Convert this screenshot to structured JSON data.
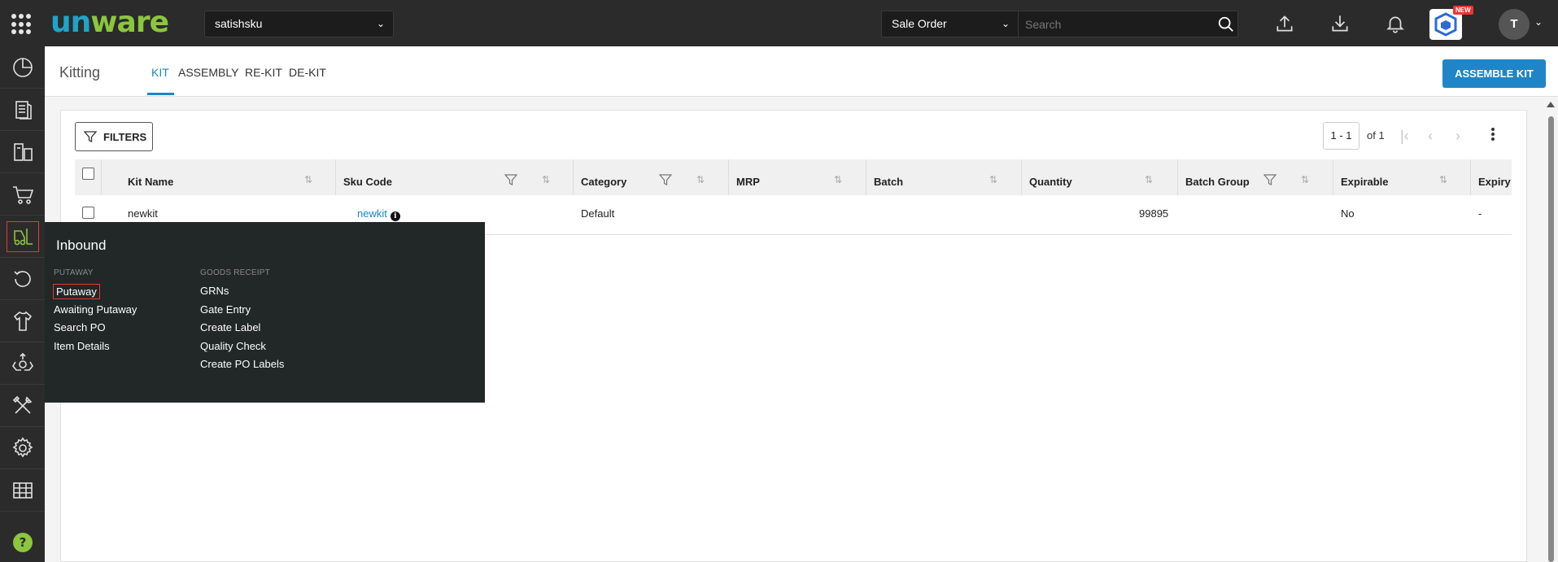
{
  "topbar": {
    "logo_part1": "un",
    "logo_part2": "ware",
    "tenant": "satishsku",
    "search_type": "Sale Order",
    "search_placeholder": "Search",
    "new_badge": "NEW",
    "avatar_initial": "T"
  },
  "header": {
    "title": "Kitting",
    "tabs": [
      {
        "label": "KIT"
      },
      {
        "label": "ASSEMBLY"
      },
      {
        "label": "RE-KIT"
      },
      {
        "label": "DE-KIT"
      }
    ],
    "assemble_button": "ASSEMBLE KIT"
  },
  "toolbar": {
    "filters_label": "FILTERS",
    "pager_range": "1 - 1",
    "pager_of": "of 1"
  },
  "table": {
    "columns": [
      "Kit Name",
      "Sku Code",
      "Category",
      "MRP",
      "Batch",
      "Quantity",
      "Batch Group",
      "Expirable",
      "Expiry"
    ],
    "rows": [
      {
        "kit_name": "newkit",
        "sku_code": "newkit",
        "category": "Default",
        "mrp": "",
        "batch": "",
        "quantity": "99895",
        "batch_group": "",
        "expirable": "No",
        "expiry": "-"
      }
    ]
  },
  "flyout": {
    "title": "Inbound",
    "sections": [
      {
        "heading": "PUTAWAY",
        "items": [
          "Putaway",
          "Awaiting Putaway",
          "Search PO",
          "Item Details"
        ]
      },
      {
        "heading": "GOODS RECEIPT",
        "items": [
          "GRNs",
          "Gate Entry",
          "Create Label",
          "Quality Check",
          "Create PO Labels"
        ]
      }
    ]
  },
  "nav_icons": [
    "dashboard-icon",
    "orders-icon",
    "products-icon",
    "cart-icon",
    "inbound-forklift-icon",
    "returns-icon",
    "apparel-icon",
    "recycle-icon",
    "tools-icon",
    "settings-icon",
    "warehouse-icon",
    "help-icon"
  ],
  "colors": {
    "accent": "#1f85c6",
    "topbar": "#2b2b2b",
    "flyout": "#222727",
    "highlight": "#e53935"
  }
}
